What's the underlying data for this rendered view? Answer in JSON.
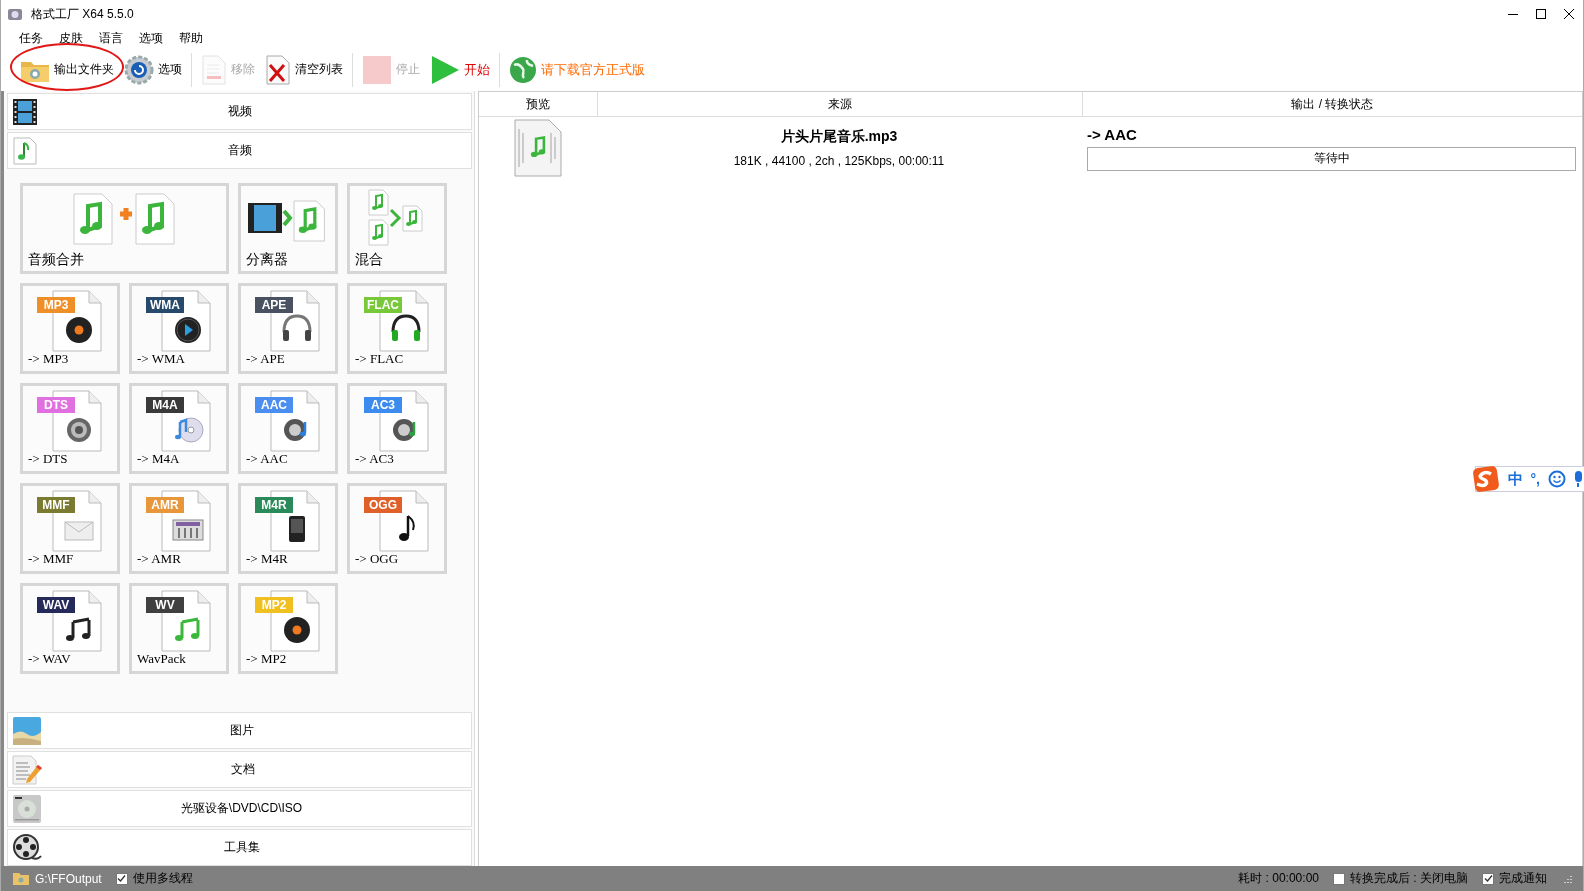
{
  "window": {
    "title": "格式工厂 X64 5.5.0"
  },
  "menu": [
    "任务",
    "皮肤",
    "语言",
    "选项",
    "帮助"
  ],
  "toolbar": [
    {
      "label": "输出文件夹",
      "disabled": false
    },
    {
      "label": "选项",
      "disabled": false
    },
    {
      "label": "移除",
      "disabled": true
    },
    {
      "label": "清空列表",
      "disabled": false
    },
    {
      "label": "停止",
      "disabled": true
    },
    {
      "label": "开始",
      "disabled": false,
      "color": "#e00000"
    },
    {
      "label": "请下载官方正式版",
      "disabled": false,
      "color": "#ff6a00"
    }
  ],
  "sidebar": {
    "categories": [
      {
        "label": "视频"
      },
      {
        "label": "音频",
        "tiles": [
          {
            "kind": "wide",
            "label": "音频合并"
          },
          {
            "kind": "tool",
            "label": "分离器"
          },
          {
            "kind": "tool",
            "label": "混合"
          },
          {
            "kind": "format",
            "badge": "MP3",
            "color": "#ef8f28",
            "label": "-> MP3"
          },
          {
            "kind": "format",
            "badge": "WMA",
            "color": "#27496b",
            "label": "-> WMA"
          },
          {
            "kind": "format",
            "badge": "APE",
            "color": "#4a5262",
            "label": "-> APE"
          },
          {
            "kind": "format",
            "badge": "FLAC",
            "color": "#78c83a",
            "label": "-> FLAC"
          },
          {
            "kind": "format",
            "badge": "DTS",
            "color": "#e070e0",
            "label": "-> DTS"
          },
          {
            "kind": "format",
            "badge": "M4A",
            "color": "#3a3a3a",
            "label": "-> M4A"
          },
          {
            "kind": "format",
            "badge": "AAC",
            "color": "#4a8ef0",
            "label": "-> AAC"
          },
          {
            "kind": "format",
            "badge": "AC3",
            "color": "#3c8cf0",
            "label": "-> AC3"
          },
          {
            "kind": "format",
            "badge": "MMF",
            "color": "#7a7a30",
            "label": "-> MMF"
          },
          {
            "kind": "format",
            "badge": "AMR",
            "color": "#e8963a",
            "label": "-> AMR"
          },
          {
            "kind": "format",
            "badge": "M4R",
            "color": "#2a8a5a",
            "label": "-> M4R"
          },
          {
            "kind": "format",
            "badge": "OGG",
            "color": "#e0602a",
            "label": "-> OGG"
          },
          {
            "kind": "format",
            "badge": "WAV",
            "color": "#252a5a",
            "label": "-> WAV"
          },
          {
            "kind": "format",
            "badge": "WV",
            "color": "#404040",
            "label": "WavPack"
          },
          {
            "kind": "format",
            "badge": "MP2",
            "color": "#f0c020",
            "label": "-> MP2"
          }
        ]
      },
      {
        "label": "图片"
      },
      {
        "label": "文档"
      },
      {
        "label": "光驱设备\\DVD\\CD\\ISO"
      },
      {
        "label": "工具集"
      }
    ]
  },
  "table": {
    "columns": [
      "预览",
      "来源",
      "输出 / 转换状态"
    ],
    "rows": [
      {
        "name": "片头片尾音乐.mp3",
        "details": "181K , 44100 , 2ch , 125Kbps, 00:00:11",
        "output": "-> AAC",
        "status": "等待中"
      }
    ]
  },
  "ime_bar": {
    "mode": "中",
    "punctuation": "°,"
  },
  "status_bar": {
    "path": "G:\\FFOutput",
    "left_options": [
      {
        "label": "使用多线程",
        "checked": true
      }
    ],
    "elapsed": "耗时 : 00:00:00",
    "right_options": [
      {
        "label": "转换完成后 : 关闭电脑",
        "checked": false
      },
      {
        "label": "完成通知",
        "checked": true
      }
    ]
  }
}
